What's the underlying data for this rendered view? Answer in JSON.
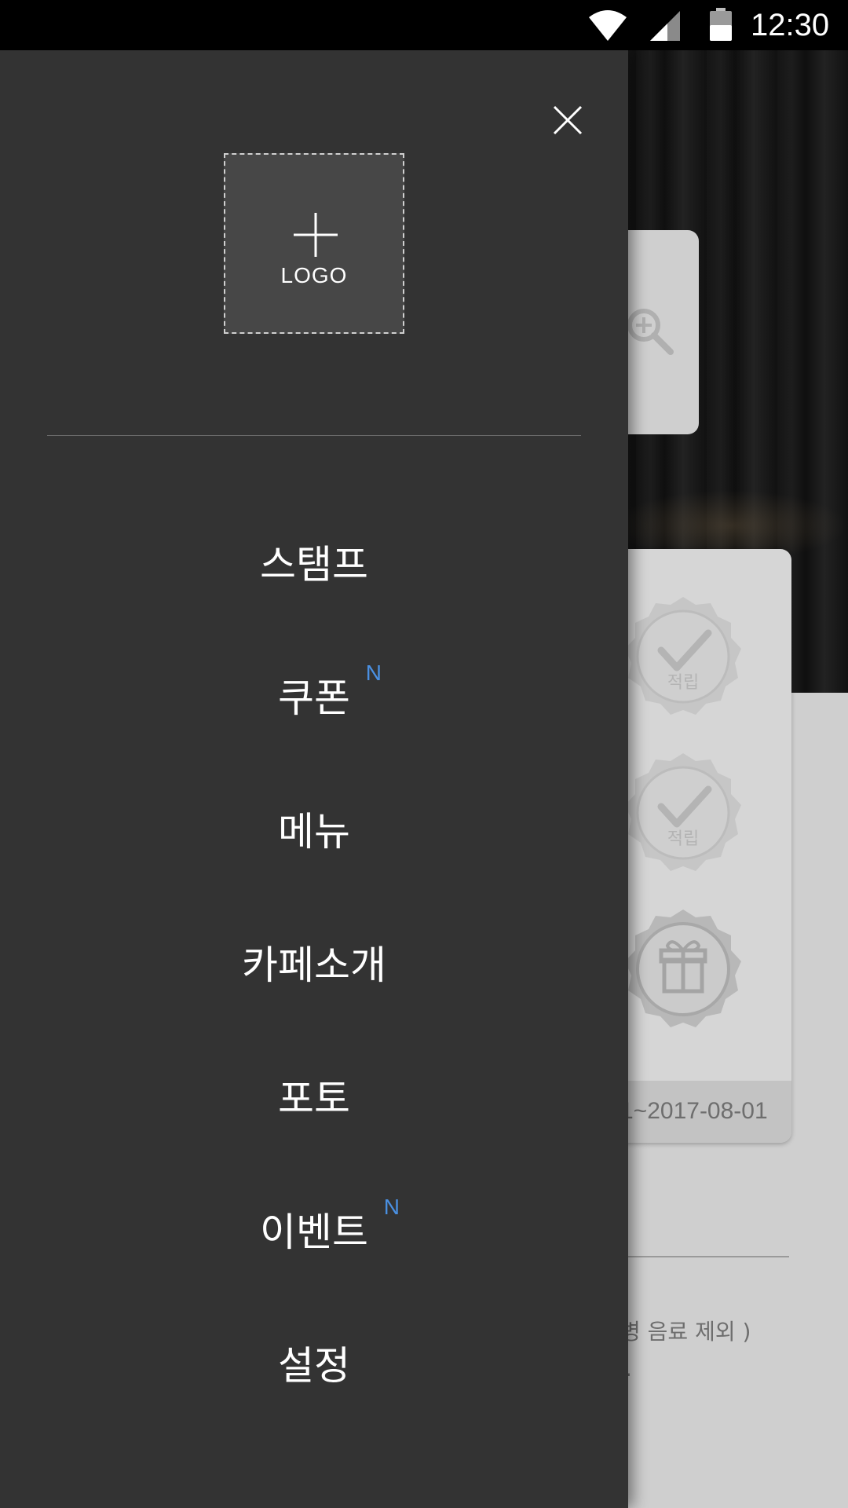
{
  "status_bar": {
    "time": "12:30",
    "icons": [
      "wifi-icon",
      "signal-icon",
      "battery-icon"
    ]
  },
  "drawer": {
    "logo_label": "LOGO",
    "menu": [
      {
        "label": "스탬프",
        "badge": ""
      },
      {
        "label": "쿠폰",
        "badge": "N"
      },
      {
        "label": "메뉴",
        "badge": ""
      },
      {
        "label": "카페소개",
        "badge": ""
      },
      {
        "label": "포토",
        "badge": ""
      },
      {
        "label": "이벤트",
        "badge": "N"
      },
      {
        "label": "설정",
        "badge": ""
      }
    ]
  },
  "background": {
    "date_range_fragment": "1~2017-08-01",
    "note_fragment_1": "병 음료 제외 )",
    "note_fragment_2": ".",
    "stamps": [
      "적립",
      "적립",
      "gift"
    ]
  },
  "colors": {
    "drawer_bg": "#333333",
    "badge": "#4a90e2",
    "logo_box": "#474747"
  }
}
